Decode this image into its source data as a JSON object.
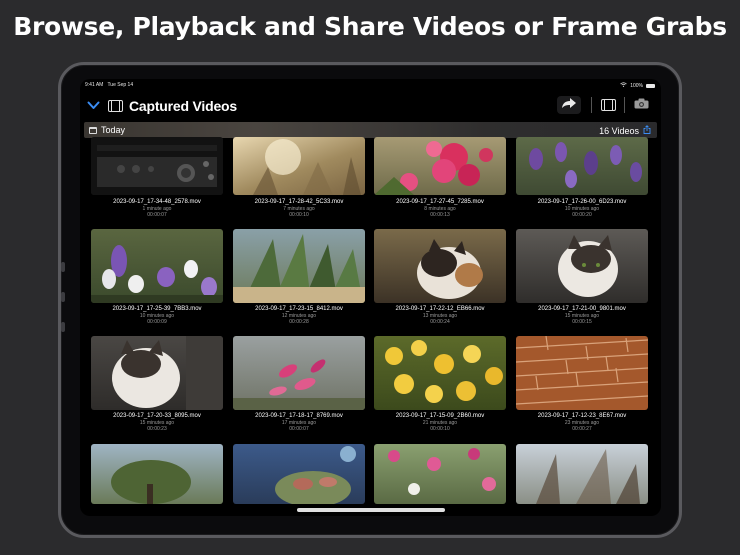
{
  "headline": "Browse, Playback and Share Videos or Frame Grabs",
  "status_bar": {
    "time": "9:41 AM",
    "date": "Tue Sep 14",
    "battery": "100%"
  },
  "nav": {
    "title": "Captured Videos",
    "icons": [
      "chevron-down-icon",
      "film-icon",
      "share-forward-icon",
      "film-icon",
      "camera-icon"
    ]
  },
  "section": {
    "label": "Today",
    "count": "16 Videos"
  },
  "colors": {
    "accent": "#3b8df3",
    "background": "#000000",
    "page": "#2b2b2d"
  },
  "videos": [
    {
      "name": "2023-09-17_17-34-48_2578.mov",
      "ago": "1 minute ago",
      "duration": "00:00:07"
    },
    {
      "name": "2023-09-17_17-28-42_5C33.mov",
      "ago": "7 minutes ago",
      "duration": "00:00:10"
    },
    {
      "name": "2023-09-17_17-27-45_7285.mov",
      "ago": "8 minutes ago",
      "duration": "00:00:13"
    },
    {
      "name": "2023-09-17_17-26-00_6D23.mov",
      "ago": "10 minutes ago",
      "duration": "00:00:20"
    },
    {
      "name": "2023-09-17_17-25-39_7BB3.mov",
      "ago": "10 minutes ago",
      "duration": "00:00:09"
    },
    {
      "name": "2023-09-17_17-23-15_8412.mov",
      "ago": "12 minutes ago",
      "duration": "00:00:28"
    },
    {
      "name": "2023-09-17_17-22-12_EB66.mov",
      "ago": "13 minutes ago",
      "duration": "00:00:24"
    },
    {
      "name": "2023-09-17_17-21-00_9801.mov",
      "ago": "15 minutes ago",
      "duration": "00:00:15"
    },
    {
      "name": "2023-09-17_17-20-33_8095.mov",
      "ago": "15 minutes ago",
      "duration": "00:00:23"
    },
    {
      "name": "2023-09-17_17-18-17_8769.mov",
      "ago": "17 minutes ago",
      "duration": "00:00:07"
    },
    {
      "name": "2023-09-17_17-15-09_2B60.mov",
      "ago": "21 minutes ago",
      "duration": "00:00:10"
    },
    {
      "name": "2023-09-17_17-12-23_8E67.mov",
      "ago": "23 minutes ago",
      "duration": "00:00:27"
    },
    {
      "name": "",
      "ago": "",
      "duration": ""
    },
    {
      "name": "",
      "ago": "",
      "duration": ""
    },
    {
      "name": "",
      "ago": "",
      "duration": ""
    },
    {
      "name": "",
      "ago": "",
      "duration": ""
    }
  ]
}
